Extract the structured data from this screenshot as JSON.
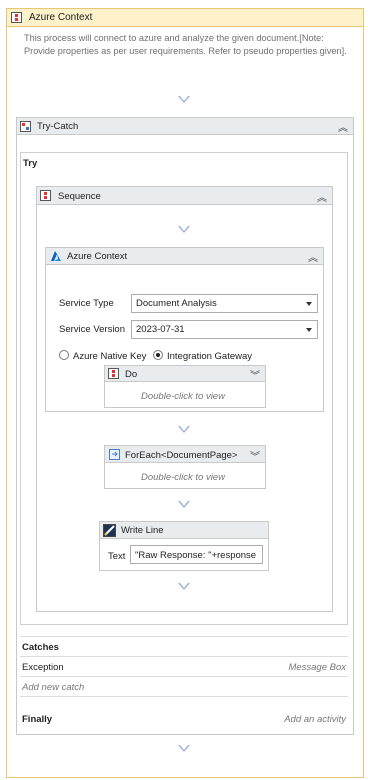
{
  "outer": {
    "title": "Azure Context",
    "description": "This process will connect to azure and analyze the given document.[Note: Provide properties as per user requirements. Refer to pseudo properties given]."
  },
  "try_catch": {
    "title": "Try-Catch",
    "try_label": "Try"
  },
  "sequence": {
    "title": "Sequence"
  },
  "azure_inner": {
    "title": "Azure Context",
    "service_type_label": "Service Type",
    "service_type_value": "Document Analysis",
    "service_version_label": "Service Version",
    "service_version_value": "2023-07-31",
    "radio_native": "Azure Native Key",
    "radio_gateway": "Integration Gateway"
  },
  "do_block": {
    "title": "Do",
    "hint": "Double-click to view"
  },
  "foreach": {
    "title": "ForEach<DocumentPage>",
    "hint": "Double-click to view"
  },
  "write_line": {
    "title": "Write Line",
    "text_label": "Text",
    "text_value": "\"Raw Response:  \"+response"
  },
  "catches": {
    "title": "Catches",
    "exception": "Exception",
    "exception_action": "Message Box",
    "add_catch": "Add new catch"
  },
  "finally": {
    "title": "Finally",
    "add_activity": "Add an activity"
  },
  "colors": {
    "header_yellow": "#fdf2c9",
    "header_gray": "#e9ecef",
    "arrow": "#9bb3d4"
  }
}
